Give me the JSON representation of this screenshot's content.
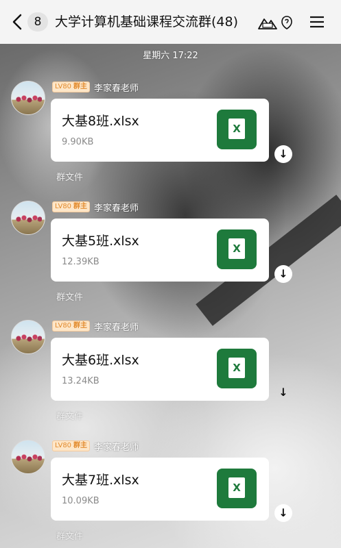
{
  "header": {
    "unread_count": "8",
    "title": "大学计算机基础课程交流群(48)",
    "icons": [
      "back-icon",
      "group-avatar-icon",
      "verified-icon",
      "menu-icon"
    ]
  },
  "timestamp": "星期六 17:22",
  "messages": [
    {
      "level": "LV80",
      "role": "群主",
      "sender": "李家春老师",
      "file_name": "大基8班.xlsx",
      "file_size": "9.90KB",
      "source": "群文件"
    },
    {
      "level": "LV80",
      "role": "群主",
      "sender": "李家春老师",
      "file_name": "大基5班.xlsx",
      "file_size": "12.39KB",
      "source": "群文件"
    },
    {
      "level": "LV80",
      "role": "群主",
      "sender": "李家春老师",
      "file_name": "大基6班.xlsx",
      "file_size": "13.24KB",
      "source": "群文件"
    },
    {
      "level": "LV80",
      "role": "群主",
      "sender": "李家春老师",
      "file_name": "大基7班.xlsx",
      "file_size": "10.09KB",
      "source": "群文件"
    }
  ],
  "colors": {
    "excel_green": "#1e7a3c",
    "badge_bg": "#fde6c8",
    "badge_text": "#e28a2c"
  }
}
